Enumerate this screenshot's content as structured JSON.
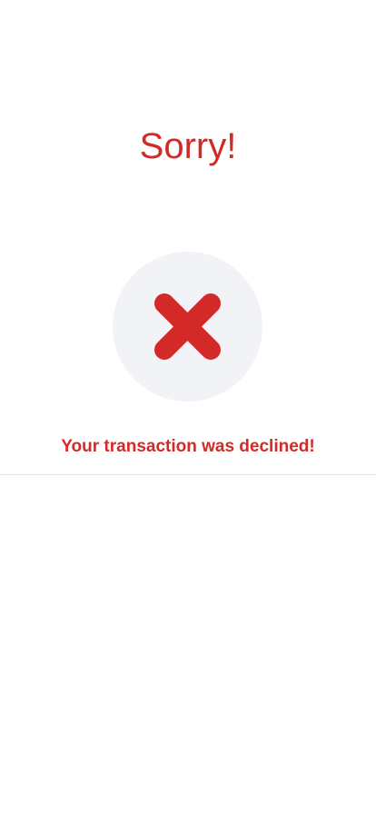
{
  "screen": {
    "title": "Sorry!",
    "status_icon": "close-x-icon",
    "message": "Your transaction was declined!"
  },
  "colors": {
    "accent_red": "#d42a27",
    "icon_circle_bg": "#f2f3f7",
    "divider": "#e4e4e4",
    "background": "#ffffff"
  }
}
